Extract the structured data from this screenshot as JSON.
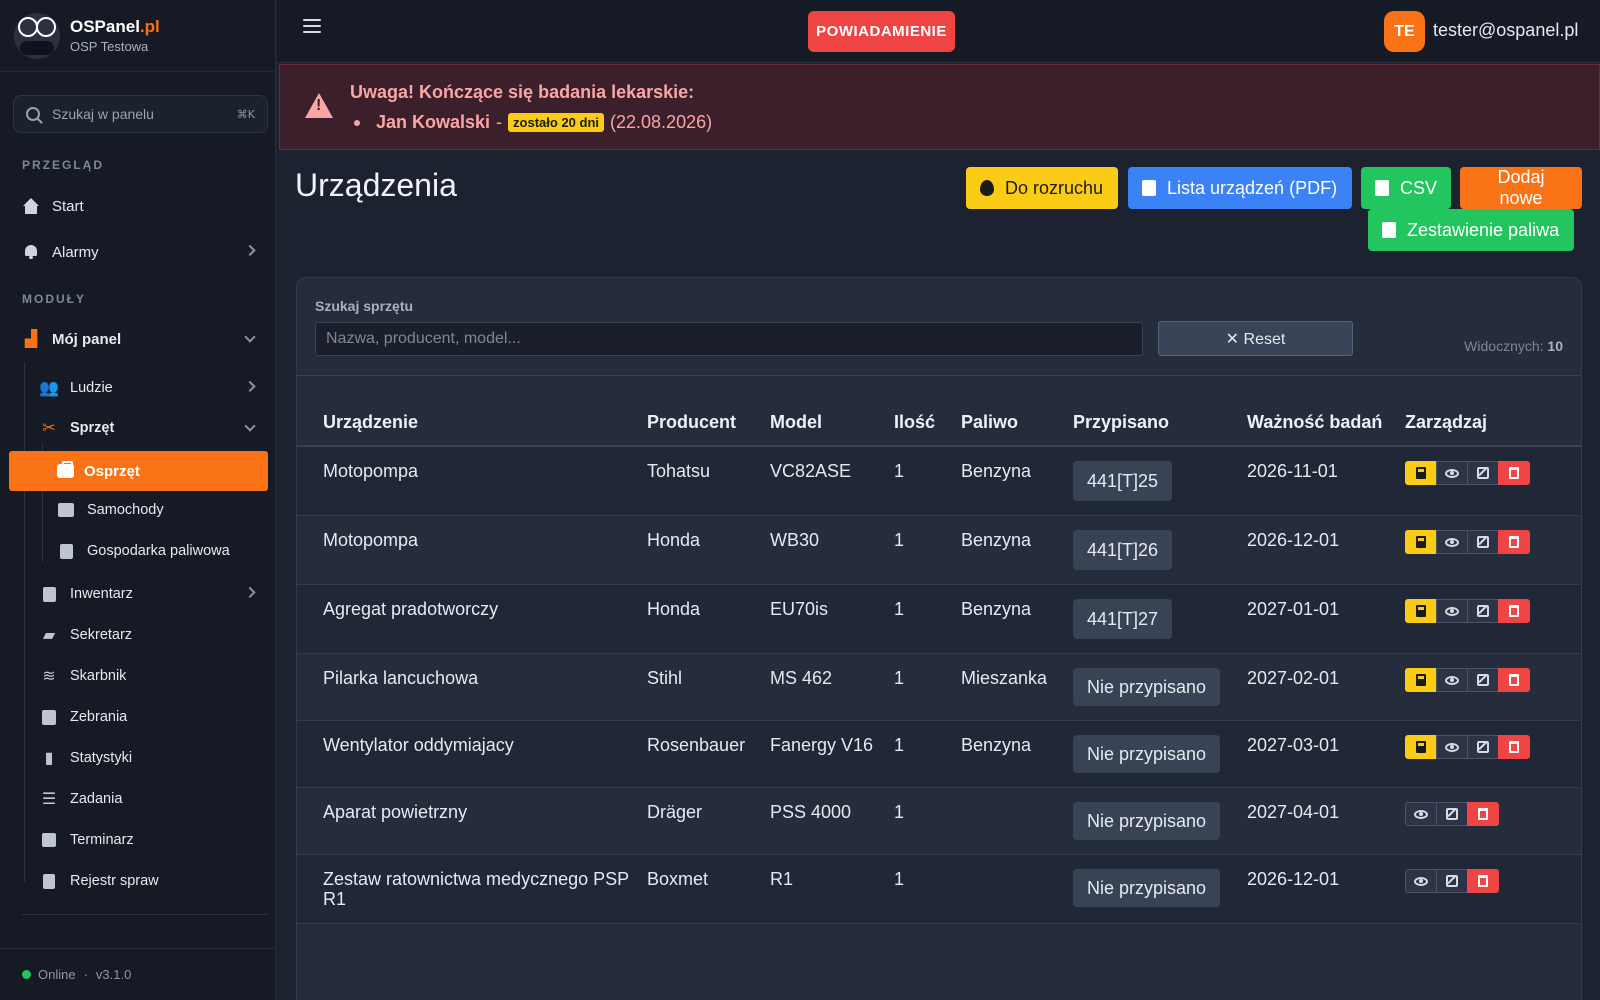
{
  "brand": {
    "name": "OSPanel",
    "suffix": ".pl",
    "sub": "OSP Testowa"
  },
  "search": {
    "placeholder": "Szukaj w panelu",
    "shortcut": "⌘K"
  },
  "sidebar": {
    "section_overview": "PRZEGLĄD",
    "section_modules": "MODUŁY",
    "start": "Start",
    "alarmy": "Alarmy",
    "moj_panel": "Mój panel",
    "ludzie": "Ludzie",
    "sprzet": "Sprzęt",
    "osprzet": "Osprzęt",
    "samochody": "Samochody",
    "gospodarka": "Gospodarka paliwowa",
    "inwentarz": "Inwentarz",
    "sekretarz": "Sekretarz",
    "skarbnik": "Skarbnik",
    "zebrania": "Zebrania",
    "statystyki": "Statystyki",
    "zadania": "Zadania",
    "terminarz": "Terminarz",
    "rejestr": "Rejestr spraw",
    "status": "Online",
    "separator": "·",
    "version": "v3.1.0"
  },
  "topbar": {
    "notify_label": "POWIADAMIENIE",
    "avatar": "TE",
    "email": "tester@ospanel.pl"
  },
  "alert": {
    "title": "Uwaga! Kończące się badania lekarskie:",
    "person": "Jan Kowalski",
    "dash": "-",
    "badge": "zostało 20 dni",
    "date": "(22.08.2026)"
  },
  "page": {
    "title": "Urządzenia",
    "btn_start": "Do rozruchu",
    "btn_pdf": "Lista urządzeń (PDF)",
    "btn_csv": "CSV",
    "btn_add": "Dodaj nowe",
    "btn_fuel": "Zestawienie paliwa"
  },
  "filter": {
    "label": "Szukaj sprzętu",
    "placeholder": "Nazwa, producent, model...",
    "reset": "✕ Reset",
    "visible_label": "Widocznych:",
    "visible_count": "10"
  },
  "table": {
    "headers": [
      "Urządzenie",
      "Producent",
      "Model",
      "Ilość",
      "Paliwo",
      "Przypisano",
      "Ważność badań",
      "Zarządzaj"
    ],
    "rows": [
      {
        "name": "Motopompa",
        "producer": "Tohatsu",
        "model": "VC82ASE",
        "qty": "1",
        "fuel": "Benzyna",
        "assigned": "441[T]25",
        "valid": "2026-11-01"
      },
      {
        "name": "Motopompa",
        "producer": "Honda",
        "model": "WB30",
        "qty": "1",
        "fuel": "Benzyna",
        "assigned": "441[T]26",
        "valid": "2026-12-01"
      },
      {
        "name": "Agregat pradotworczy",
        "producer": "Honda",
        "model": "EU70is",
        "qty": "1",
        "fuel": "Benzyna",
        "assigned": "441[T]27",
        "valid": "2027-01-01"
      },
      {
        "name": "Pilarka lancuchowa",
        "producer": "Stihl",
        "model": "MS 462",
        "qty": "1",
        "fuel": "Mieszanka",
        "assigned": "Nie przypisano",
        "valid": "2027-02-01"
      },
      {
        "name": "Wentylator oddymiajacy",
        "producer": "Rosenbauer",
        "model": "Fanergy V16",
        "qty": "1",
        "fuel": "Benzyna",
        "assigned": "Nie przypisano",
        "valid": "2027-03-01"
      },
      {
        "name": "Aparat powietrzny",
        "producer": "Dräger",
        "model": "PSS 4000",
        "qty": "1",
        "fuel": "",
        "assigned": "Nie przypisano",
        "valid": "2027-04-01"
      },
      {
        "name": "Zestaw ratownictwa medycznego PSP R1",
        "producer": "Boxmet",
        "model": "R1",
        "qty": "1",
        "fuel": "",
        "assigned": "Nie przypisano",
        "valid": "2026-12-01"
      }
    ]
  },
  "colors": {
    "accent": "#f97316",
    "danger": "#ef4444",
    "warning": "#facc15",
    "primary": "#3b82f6",
    "success": "#22c55e"
  }
}
